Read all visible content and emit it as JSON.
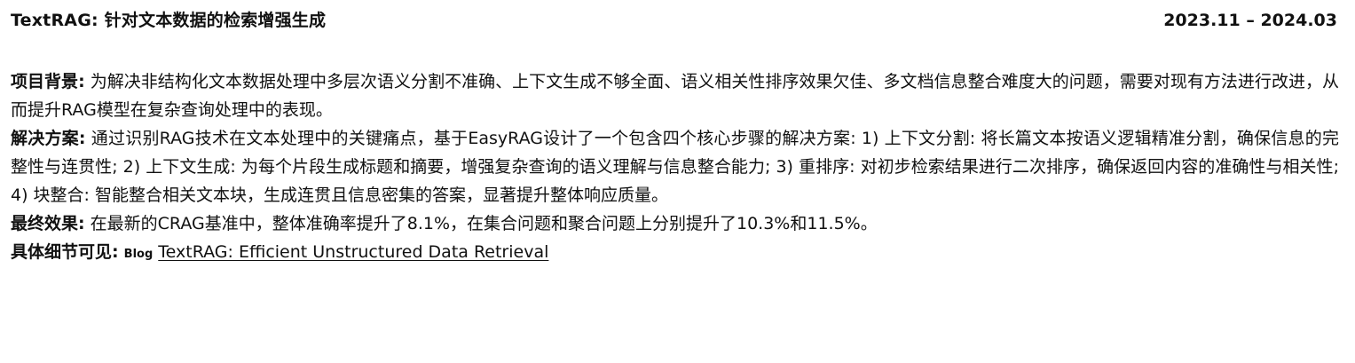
{
  "header": {
    "title": "TextRAG: 针对文本数据的检索增强生成",
    "period": "2023.11 – 2024.03"
  },
  "background": {
    "label": "项目背景:",
    "text": " 为解决非结构化文本数据处理中多层次语义分割不准确、上下文生成不够全面、语义相关性排序效果欠佳、多文档信息整合难度大的问题，需要对现有方法进行改进，从而提升RAG模型在复杂查询处理中的表现。"
  },
  "solution": {
    "label": "解决方案:",
    "text": " 通过识别RAG技术在文本处理中的关键痛点，基于EasyRAG设计了一个包含四个核心步骤的解决方案: 1) 上下文分割: 将长篇文本按语义逻辑精准分割，确保信息的完整性与连贯性; 2) 上下文生成: 为每个片段生成标题和摘要，增强复杂查询的语义理解与信息整合能力; 3) 重排序: 对初步检索结果进行二次排序，确保返回内容的准确性与相关性; 4) 块整合: 智能整合相关文本块，生成连贯且信息密集的答案，显著提升整体响应质量。"
  },
  "result": {
    "label": "最终效果:",
    "text": " 在最新的CRAG基准中，整体准确率提升了8.1%，在集合问题和聚合问题上分别提升了10.3%和11.5%。"
  },
  "details": {
    "label": "具体细节可见:",
    "blog_tag": "Blog",
    "link_text": "TextRAG: Efficient Unstructured Data Retrieval"
  }
}
